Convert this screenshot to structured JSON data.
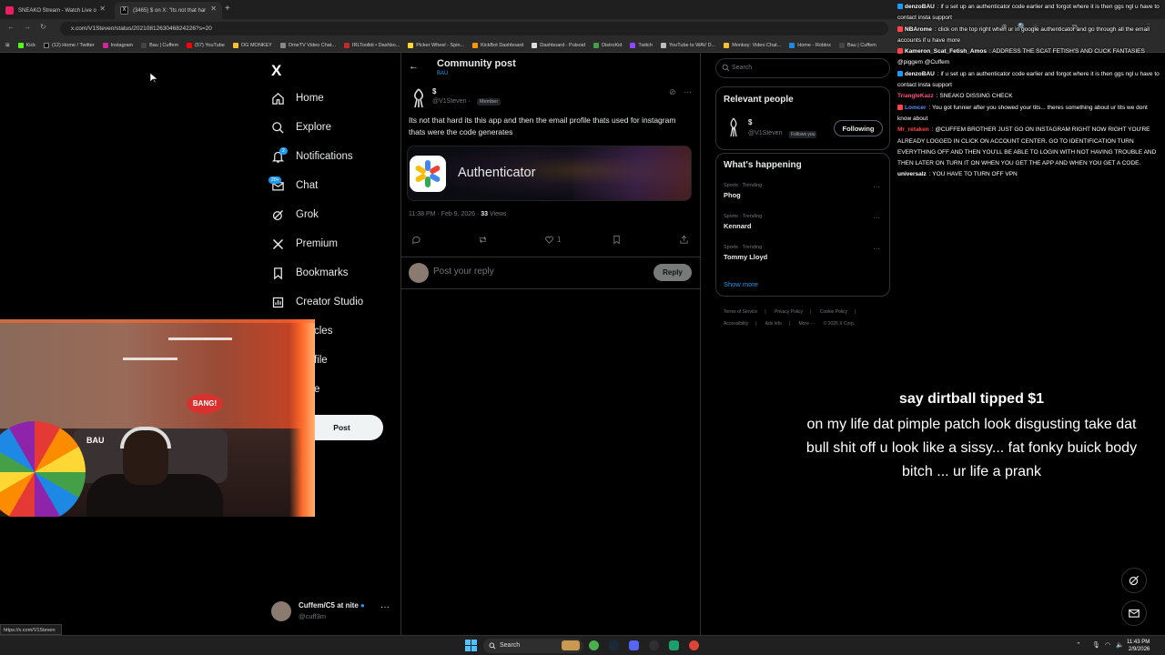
{
  "browser": {
    "tabs": [
      {
        "label": "SNEAKO Stream - Watch Live o",
        "active": false
      },
      {
        "label": "(3465) $ on X: \"Its not that har",
        "active": true
      }
    ],
    "url": "x.com/V1Steven/status/2021081263046824226?s=20",
    "bookmarks": [
      "Kick",
      "(12) Home / Twitter",
      "Instagram",
      "Bau | Cuffem",
      "(57) YouTube",
      "OG MONKEY",
      "OmeTV Video Chat...",
      "IRLToolkit • Dashbo...",
      "Picker Wheel - Spin...",
      "KickBot Dashboard",
      "Dashboard - Pulsoid",
      "DistroKid",
      "Twitch",
      "YouTube to WAV D...",
      "Monkey: Video Chat...",
      "Home - Roblox",
      "Bau | Cuffem"
    ],
    "all_bookmarks": "All Bookmarks",
    "status_url": "https://x.com/V1Steven"
  },
  "left_nav": {
    "logo": "X",
    "items": [
      {
        "label": "Home",
        "icon": "home-icon"
      },
      {
        "label": "Explore",
        "icon": "search-icon"
      },
      {
        "label": "Notifications",
        "icon": "bell-icon",
        "badge": "2"
      },
      {
        "label": "Chat",
        "icon": "mail-icon",
        "badge": "20+"
      },
      {
        "label": "Grok",
        "icon": "grok-icon"
      },
      {
        "label": "Premium",
        "icon": "x-icon"
      },
      {
        "label": "Bookmarks",
        "icon": "bookmark-icon"
      },
      {
        "label": "Creator Studio",
        "icon": "creator-icon"
      },
      {
        "label": "cles",
        "icon": "article-icon"
      },
      {
        "label": "file",
        "icon": "profile-icon"
      },
      {
        "label": "e",
        "icon": "more-icon"
      }
    ],
    "post_label": "Post",
    "account": {
      "name": "Cuffem/C5 at nite",
      "handle": "@cuff3m",
      "more": "···"
    }
  },
  "post": {
    "header_title": "Community post",
    "header_sub": "BAU",
    "author_name": "$",
    "author_handle": "@V1Steven",
    "author_badge": "Member",
    "text": "Its not that hard its this app and then the email profile thats used for instagram thats were the code generates",
    "card_label": "Authenticator",
    "time": "11:38 PM · Feb 9, 2026 · ",
    "views_count": "33",
    "views_label": " Views",
    "like_count": "1",
    "reply_placeholder": "Post your reply",
    "reply_button": "Reply"
  },
  "sidebar": {
    "search_placeholder": "Search",
    "relevant_title": "Relevant people",
    "person": {
      "name": "$",
      "handle": "@V1Steven",
      "follows_you": "Follows you",
      "button": "Following"
    },
    "happening_title": "What's happening",
    "trends": [
      {
        "category": "Sports · Trending",
        "name": "Phog"
      },
      {
        "category": "Sports · Trending",
        "name": "Kennard"
      },
      {
        "category": "Sports · Trending",
        "name": "Tommy Lloyd"
      }
    ],
    "show_more": "Show more",
    "footer": [
      "Terms of Service",
      "|",
      "Privacy Policy",
      "|",
      "Cookie Policy",
      "|",
      "Accessibility",
      "|",
      "Ads info",
      "|",
      "More ···",
      "© 2026 X Corp."
    ]
  },
  "webcam": {
    "sign_text": "BANG!",
    "sofa_text": "BAU"
  },
  "chat": [
    {
      "user": "denzoBAU",
      "color": "#ffffff",
      "text": "if u set up an authenticator code earlier and forgot where it is then ggs ngl u have to contact insta support"
    },
    {
      "user": "NBArome",
      "color": "#ffffff",
      "text": "click on the top right when ur in google authenticator and go through all the email accounts if u have more"
    },
    {
      "user": "Kameron_Scat_Fetish_Amos",
      "color": "#ffffff",
      "text": "ADDRESS THE SCAT FETISH'S AND CUCK FANTASIES @piggem @Cuffem"
    },
    {
      "user": "denzoBAU",
      "color": "#ffffff",
      "text": "if u set up an authenticator code earlier and forgot where it is then ggs ngl u have to contact insta support"
    },
    {
      "user": "TriangleKazz",
      "color": "#ff4f7e",
      "text": "SNEAKO DISSING CHECK"
    },
    {
      "user": "Lomcer",
      "color": "#5c8dff",
      "text": "You got funnier after you showed your tits... theres something about ur tits we dont know about"
    },
    {
      "user": "Mr_retaken",
      "color": "#ff4444",
      "text": "@CUFFEM BROTHER JUST GO ON INSTAGRAM RIGHT NOW RIGHT YOU'RE ALREADY LOGGED IN CLICK ON ACCOUNT CENTER. GO TO IDENTIFICATION TURN EVERYTHING OFF AND THEN YOU'LL BE ABLE TO LOGIN WITH NOT HAVING TROUBLE AND THEN LATER ON TURN IT ON WHEN YOU GET THE APP AND WHEN YOU GET A CODE."
    },
    {
      "user": "universalz",
      "color": "#ffffff",
      "text": "YOU HAVE TO TURN OFF VPN"
    }
  ],
  "tts": {
    "tip": "say dirtball tipped $1",
    "message": "on my life dat pimple patch look disgusting take dat bull shit off u look like a sissy... fat fonky buick body bitch ... ur life a prank"
  },
  "taskbar": {
    "search": "Search",
    "time": "11:43 PM",
    "date": "2/9/2026"
  }
}
